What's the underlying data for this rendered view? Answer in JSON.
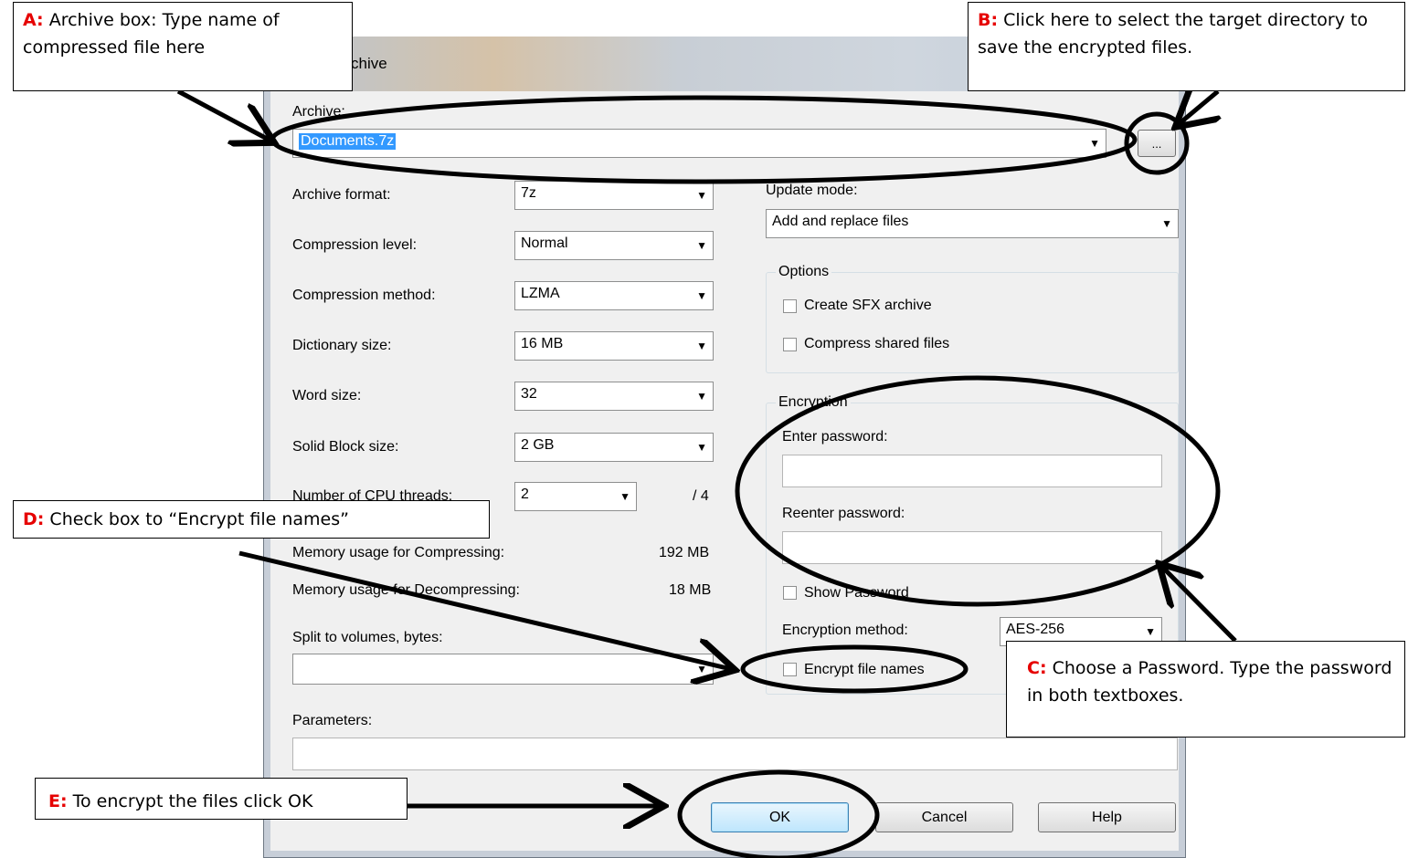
{
  "window": {
    "title": "Add to Archive",
    "visible_title": "chive"
  },
  "archive": {
    "label": "Archive:",
    "value": "Documents.7z",
    "browse_label": "..."
  },
  "left": [
    {
      "label": "Archive format:",
      "value": "7z"
    },
    {
      "label": "Compression level:",
      "value": "Normal"
    },
    {
      "label": "Compression method:",
      "value": "LZMA"
    },
    {
      "label": "Dictionary size:",
      "value": "16 MB"
    },
    {
      "label": "Word size:",
      "value": "32"
    },
    {
      "label": "Solid Block size:",
      "value": "2 GB"
    }
  ],
  "threads": {
    "label": "Number of CPU threads:",
    "value": "2",
    "max": "/ 4"
  },
  "memory": {
    "compress_label": "Memory usage for Compressing:",
    "compress_value": "192 MB",
    "decompress_label": "Memory usage for Decompressing:",
    "decompress_value": "18 MB"
  },
  "split": {
    "label": "Split to volumes, bytes:",
    "value": ""
  },
  "parameters": {
    "label": "Parameters:",
    "value": ""
  },
  "update": {
    "label": "Update mode:",
    "value": "Add and replace files"
  },
  "options": {
    "title": "Options",
    "sfx_label": "Create SFX archive",
    "shared_label": "Compress shared files"
  },
  "encryption": {
    "title": "Encryption",
    "enter_label": "Enter password:",
    "reenter_label": "Reenter password:",
    "show_label": "Show Password",
    "method_label": "Encryption method:",
    "method_value": "AES-256",
    "names_label": "Encrypt file names"
  },
  "buttons": {
    "ok": "OK",
    "cancel": "Cancel",
    "help": "Help"
  },
  "callouts": {
    "a_letter": "A:",
    "a_text": "Archive box:  Type name of compressed file here",
    "b_letter": "B:",
    "b_text": "Click here to select the target directory to save the encrypted files.",
    "c_letter": "C:",
    "c_text": "Choose a Password. Type the password in both textboxes.",
    "d_letter": "D:",
    "d_text": "Check box to “Encrypt file names”",
    "e_letter": "E:",
    "e_text": "To encrypt the files click OK"
  },
  "colors": {
    "callout_letter": "#e60000",
    "client_bg": "#f0f0f0"
  }
}
